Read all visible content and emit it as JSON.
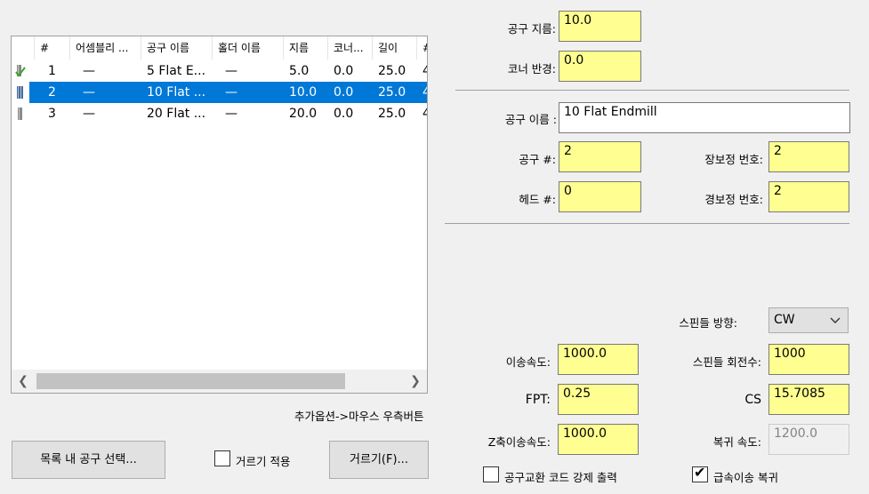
{
  "tool_list": {
    "columns": [
      "#",
      "어셈블리 ...",
      "공구 이름",
      "홀더 이름",
      "지름",
      "코너...",
      "길이",
      "#"
    ],
    "rows": [
      {
        "num": "1",
        "assembly": "—",
        "tool_name": "5 Flat E...",
        "holder": "—",
        "diameter": "5.0",
        "corner": "0.0",
        "length": "25.0",
        "extra": "4",
        "icon": "tool-checked-icon",
        "selected": false
      },
      {
        "num": "2",
        "assembly": "—",
        "tool_name": "10 Flat ...",
        "holder": "—",
        "diameter": "10.0",
        "corner": "0.0",
        "length": "25.0",
        "extra": "4",
        "icon": "tool-icon",
        "selected": true
      },
      {
        "num": "3",
        "assembly": "—",
        "tool_name": "20 Flat ...",
        "holder": "—",
        "diameter": "20.0",
        "corner": "0.0",
        "length": "25.0",
        "extra": "4",
        "icon": "tool-icon",
        "selected": false
      }
    ]
  },
  "hint_text": "추가옵션->마우스 우측버튼",
  "buttons": {
    "select_tool": "목록 내 공구 선택...",
    "filter_apply_label": "거르기 적용",
    "filter": "거르기(F)..."
  },
  "fields": {
    "diameter": {
      "label": "공구 지름:",
      "value": "10.0"
    },
    "corner_radius": {
      "label": "코너 반경:",
      "value": "0.0"
    },
    "tool_name": {
      "label": "공구 이름 :",
      "value": "10 Flat Endmill"
    },
    "tool_number": {
      "label": "공구 #:",
      "value": "2"
    },
    "length_offset": {
      "label": "장보정 번호:",
      "value": "2"
    },
    "head_number": {
      "label": "헤드 #:",
      "value": "0"
    },
    "diameter_offset": {
      "label": "경보정 번호:",
      "value": "2"
    },
    "spindle_direction": {
      "label": "스핀들 방향:",
      "value": "CW"
    },
    "feed_rate": {
      "label": "이송속도:",
      "value": "1000.0"
    },
    "spindle_speed": {
      "label": "스핀들 회전수:",
      "value": "1000"
    },
    "fpt": {
      "label": "FPT:",
      "value": "0.25"
    },
    "cs": {
      "label": "CS",
      "value": "15.7085"
    },
    "plunge_rate": {
      "label": "Z축이송속도:",
      "value": "1000.0"
    },
    "retract_rate": {
      "label": "복귀 속도:",
      "value": "1200.0"
    }
  },
  "checkboxes": {
    "force_tool_change": {
      "label": "공구교환 코드 강제 출력",
      "checked": false
    },
    "rapid_retract": {
      "label": "급속이송 복귀",
      "checked": true
    },
    "filter_apply": {
      "checked": false
    }
  },
  "colors": {
    "field_bg": "#ffff91",
    "selection": "#0078d7"
  }
}
